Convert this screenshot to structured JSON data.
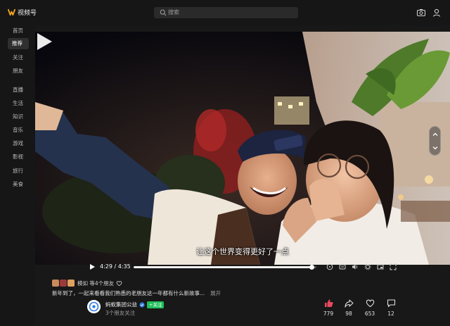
{
  "app": {
    "title": "视频号"
  },
  "search": {
    "placeholder": "搜索"
  },
  "sidebar": {
    "items": [
      {
        "label": "首页"
      },
      {
        "label": "推荐",
        "active": true
      },
      {
        "label": "关注"
      },
      {
        "label": "朋友"
      },
      {
        "label": "直播"
      },
      {
        "label": "生活"
      },
      {
        "label": "知识"
      },
      {
        "label": "音乐"
      },
      {
        "label": "游戏"
      },
      {
        "label": "影视"
      },
      {
        "label": "旅行"
      },
      {
        "label": "美食"
      }
    ]
  },
  "video": {
    "subtitle": "让这个世界变得更好了一点",
    "current_time": "4:29",
    "duration": "4:35",
    "time_display": "4:29 / 4:35",
    "progress": 0.975
  },
  "post": {
    "friends_text": "模如 等4个朋友",
    "description": "新年到了，一起来看看我们熟悉的老朋友这一年都有什么新故事...",
    "expand_label": "展开",
    "author_name": "蚂蚁集团公益",
    "follow_label": "+关注",
    "author_sub": "3个朋友关注"
  },
  "stats": {
    "likes": "779",
    "shares": "98",
    "favorites": "653",
    "comments": "12"
  },
  "colors": {
    "brand": "#f6a623",
    "like": "#e84a5f",
    "follow": "#1fbf5a",
    "verified": "#2f7be8"
  },
  "icons": [
    "logo-icon",
    "search-icon",
    "camera-icon",
    "user-icon",
    "play-icon",
    "chevron-up-icon",
    "chevron-down-icon",
    "like-icon",
    "share-icon",
    "heart-icon",
    "comment-icon"
  ]
}
